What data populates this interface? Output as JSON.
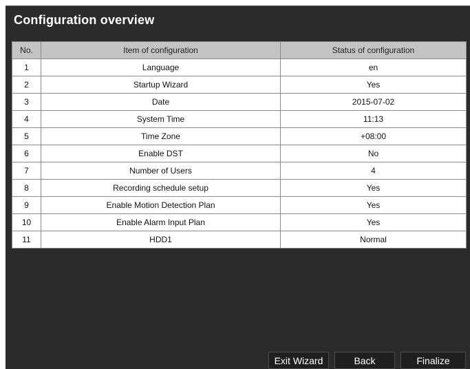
{
  "window": {
    "title": "Configuration overview"
  },
  "table": {
    "headers": [
      "No.",
      "Item of configuration",
      "Status of configuration"
    ],
    "rows": [
      {
        "no": "1",
        "item": "Language",
        "status": "en"
      },
      {
        "no": "2",
        "item": "Startup Wizard",
        "status": "Yes"
      },
      {
        "no": "3",
        "item": "Date",
        "status": "2015-07-02"
      },
      {
        "no": "4",
        "item": "System Time",
        "status": "11:13"
      },
      {
        "no": "5",
        "item": "Time Zone",
        "status": "+08:00"
      },
      {
        "no": "6",
        "item": "Enable DST",
        "status": "No"
      },
      {
        "no": "7",
        "item": "Number of Users",
        "status": "4"
      },
      {
        "no": "8",
        "item": "Recording schedule setup",
        "status": "Yes"
      },
      {
        "no": "9",
        "item": "Enable Motion Detection Plan",
        "status": "Yes"
      },
      {
        "no": "10",
        "item": "Enable Alarm Input Plan",
        "status": "Yes"
      },
      {
        "no": "11",
        "item": "HDD1",
        "status": "Normal"
      }
    ]
  },
  "buttons": {
    "exit_wizard": "Exit Wizard",
    "back": "Back",
    "finalize": "Finalize"
  },
  "colors": {
    "window_background": "#2b2b2b",
    "header_background": "#c4c4c4",
    "button_background": "#1f1f1f"
  }
}
